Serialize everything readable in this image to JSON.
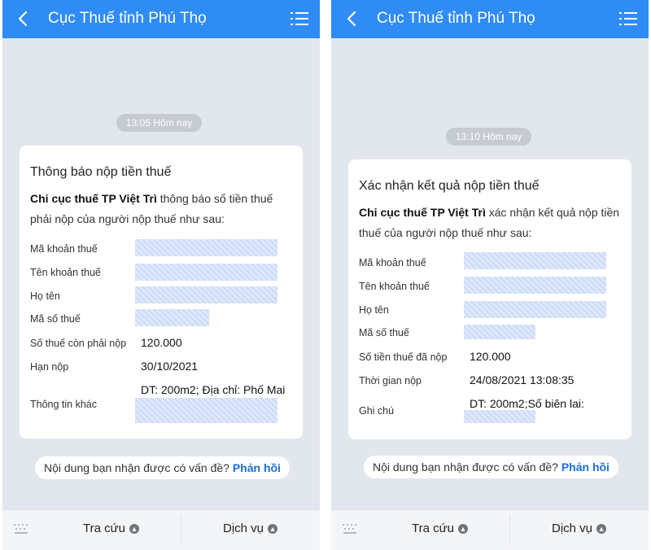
{
  "screens": [
    {
      "header": {
        "title": "Cục Thuế tỉnh Phú Thọ"
      },
      "time": "13:05 Hôm nay",
      "card": {
        "title": "Thông báo nộp tiền thuế",
        "intro_bold": "Chi cục thuế TP Việt Trì",
        "intro_text": " thông báo số tiền thuế phải nộp của người nộp thuế như sau:",
        "rows": [
          {
            "label": "Mã khoản thuế",
            "value": ""
          },
          {
            "label": "Tên khoản thuế",
            "value": ""
          },
          {
            "label": "Họ tên",
            "value": ""
          },
          {
            "label": "Mã số thuế",
            "value": ""
          },
          {
            "label": "Số thuế còn phải nộp",
            "value": "120.000"
          },
          {
            "label": "Hạn nộp",
            "value": "30/10/2021"
          },
          {
            "label": "Thông tin khác",
            "value": "DT: 200m2; Địa chỉ: Phố Mai"
          }
        ]
      },
      "feedback": {
        "text": "Nội dung bạn nhận được có vấn đề?",
        "link": "Phản hồi"
      },
      "bottom": {
        "tab1": "Tra cứu",
        "tab2": "Dịch vụ"
      }
    },
    {
      "header": {
        "title": "Cục Thuế tỉnh Phú Thọ"
      },
      "time": "13:10 Hôm nay",
      "card": {
        "title": "Xác nhận kết quả nộp tiền thuế",
        "intro_bold": "Chi cục thuế TP Việt Trì",
        "intro_text": " xác nhận kết quả nộp tiền thuế của người nộp thuế như sau:",
        "rows": [
          {
            "label": "Mã khoản thuế",
            "value": ""
          },
          {
            "label": "Tên khoản thuế",
            "value": ""
          },
          {
            "label": "Họ tên",
            "value": ""
          },
          {
            "label": "Mã số thuế",
            "value": ""
          },
          {
            "label": "Số tiền thuế đã nộp",
            "value": "120.000"
          },
          {
            "label": "Thời gian nộp",
            "value": "24/08/2021 13:08:35"
          },
          {
            "label": "Ghi chú",
            "value": "DT: 200m2;Số biên lai:"
          }
        ]
      },
      "feedback": {
        "text": "Nội dung bạn nhận được có vấn đề?",
        "link": "Phản hồi"
      },
      "bottom": {
        "tab1": "Tra cứu",
        "tab2": "Dịch vụ"
      }
    }
  ],
  "colors": {
    "header": "#2f8cf5",
    "background": "#e2e7ee",
    "link": "#1a6fd8",
    "redaction": "#dfe8fb"
  },
  "icons": {
    "back": "chevron-left-icon",
    "menu": "list-menu-icon",
    "keyboard": "keyboard-icon",
    "tab_caret": "chevron-up-circle-icon"
  }
}
